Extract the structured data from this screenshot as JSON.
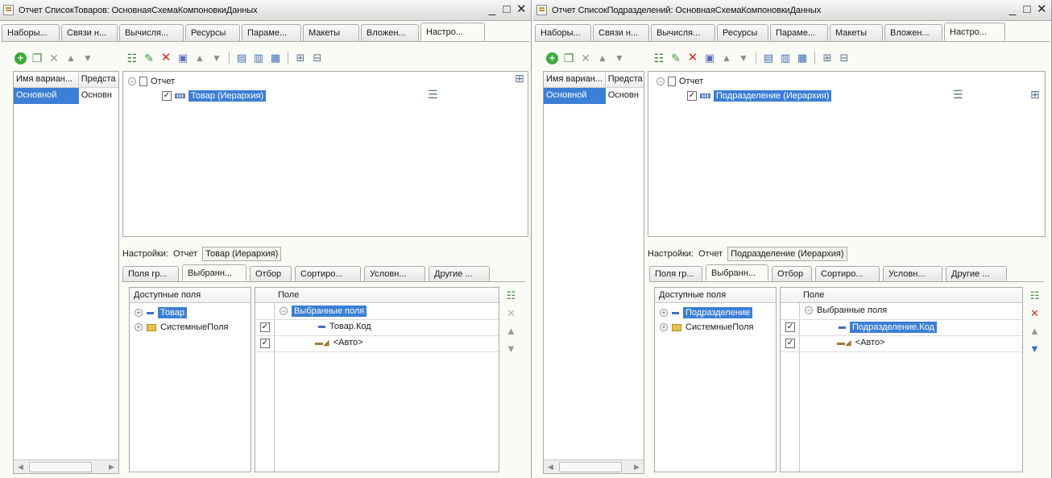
{
  "windows": [
    {
      "title": "Отчет СписокТоваров: ОсновнаяСхемаКомпоновкиДанных",
      "controls": {
        "minimize": "_",
        "maximize": "□",
        "close": "✕"
      },
      "tabs": [
        "Наборы...",
        "Связи н...",
        "Вычисля...",
        "Ресурсы",
        "Параме...",
        "Макеты",
        "Вложен...",
        "Настро..."
      ],
      "variants": {
        "col_name": "Имя вариан...",
        "col_repr": "Предста",
        "row_name": "Основной",
        "row_repr": "Основн"
      },
      "structure": {
        "root": "Отчет",
        "group": "Товар (Иерархия)"
      },
      "settings": {
        "label": "Настройки:",
        "path_root": "Отчет",
        "path_item": "Товар (Иерархия)"
      },
      "subtabs": [
        "Поля гр...",
        "Выбранн...",
        "Отбор",
        "Сортиро...",
        "Условн...",
        "Другие ..."
      ],
      "available": {
        "header": "Доступные поля",
        "items": [
          "Товар",
          "СистемныеПоля"
        ]
      },
      "selected": {
        "header": "Поле",
        "group": "Выбранные поля",
        "rows": [
          "Товар.Код",
          "<Авто>"
        ]
      }
    },
    {
      "title": "Отчет СписокПодразделений: ОсновнаяСхемаКомпоновкиДанных",
      "controls": {
        "minimize": "_",
        "maximize": "□",
        "close": "✕"
      },
      "tabs": [
        "Наборы...",
        "Связи н...",
        "Вычисля...",
        "Ресурсы",
        "Параме...",
        "Макеты",
        "Вложен...",
        "Настро..."
      ],
      "variants": {
        "col_name": "Имя вариан...",
        "col_repr": "Предста",
        "row_name": "Основной",
        "row_repr": "Основн"
      },
      "structure": {
        "root": "Отчет",
        "group": "Подразделение (Иерархия)"
      },
      "settings": {
        "label": "Настройки:",
        "path_root": "Отчет",
        "path_item": "Подразделение (Иерархия)"
      },
      "subtabs": [
        "Поля гр...",
        "Выбранн...",
        "Отбор",
        "Сортиро...",
        "Условн...",
        "Другие ..."
      ],
      "available": {
        "header": "Доступные поля",
        "items": [
          "Подразделение",
          "СистемныеПоля"
        ]
      },
      "selected": {
        "header": "Поле",
        "group": "Выбранные поля",
        "rows": [
          "Подразделение.Код",
          "<Авто>"
        ]
      }
    }
  ]
}
